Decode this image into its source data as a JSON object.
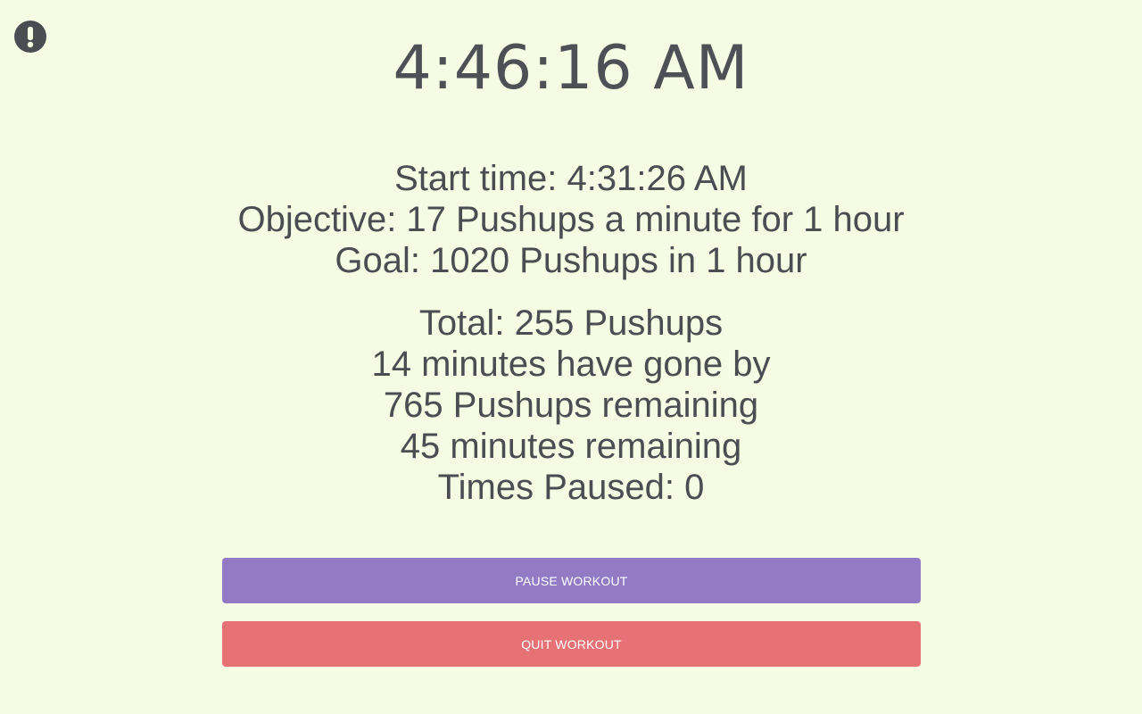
{
  "clock": {
    "current_time": "4:46:16 AM"
  },
  "alert": {
    "icon": "exclamation-circle-icon",
    "color": "#4a4e52"
  },
  "workout_plan": {
    "start_time": "Start time: 4:31:26 AM",
    "objective": "Objective: 17 Pushups a minute for 1 hour",
    "goal": "Goal: 1020 Pushups in 1 hour"
  },
  "progress": {
    "total": "Total: 255 Pushups",
    "elapsed": "14 minutes have gone by",
    "pushups_remaining": "765 Pushups remaining",
    "minutes_remaining": "45 minutes remaining",
    "times_paused": "Times Paused: 0"
  },
  "actions": {
    "pause_label": "PAUSE WORKOUT",
    "quit_label": "QUIT WORKOUT"
  },
  "colors": {
    "background": "#f6fbe4",
    "text": "#4a4e52",
    "pause_button": "#927ac5",
    "quit_button": "#e67276"
  }
}
